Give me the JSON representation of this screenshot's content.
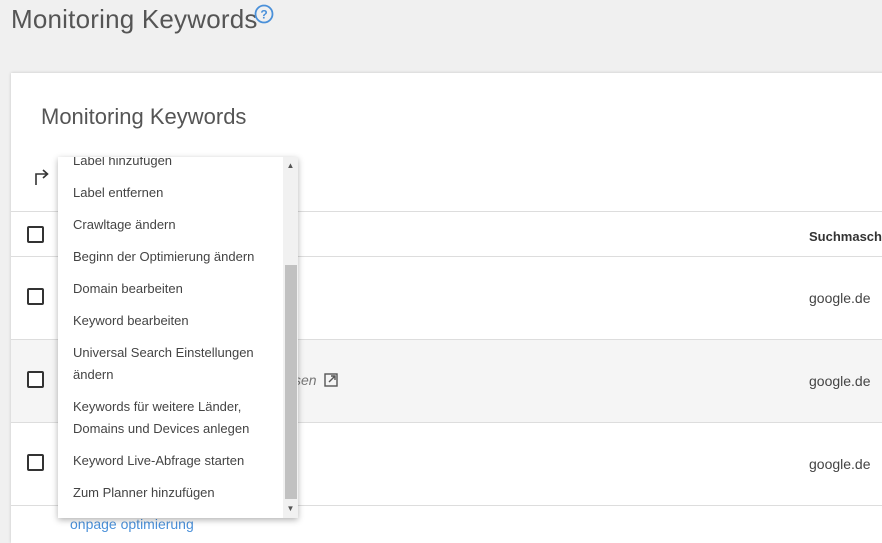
{
  "page": {
    "title": "Monitoring Keywords"
  },
  "card": {
    "title": "Monitoring Keywords"
  },
  "table": {
    "header_search_engine": "Suchmasch",
    "rows": [
      {
        "search_engine": "google.de"
      },
      {
        "search_engine": "google.de",
        "partial_text": "sen"
      },
      {
        "search_engine": "google.de"
      }
    ],
    "bottom_link": "onpage optimierung"
  },
  "dropdown": {
    "items": [
      "Label hinzufügen",
      "Label entfernen",
      "Crawltage ändern",
      "Beginn der Optimierung ändern",
      "Domain bearbeiten",
      "Keyword bearbeiten",
      "Universal Search Einstellungen",
      "ändern",
      "Keywords für weitere Länder,",
      "Domains und Devices anlegen",
      "Keyword Live-Abfrage starten",
      "Zum Planner hinzufügen"
    ],
    "scrollbar": {
      "up_icon": "triangle-up",
      "down_icon": "triangle-down"
    }
  },
  "icons": {
    "help": "question-circle-icon",
    "bulk_action": "turn-right-arrow-icon",
    "external_link": "external-link-icon"
  },
  "colors": {
    "accent": "#4a90d9",
    "background": "#f0f0f0"
  }
}
